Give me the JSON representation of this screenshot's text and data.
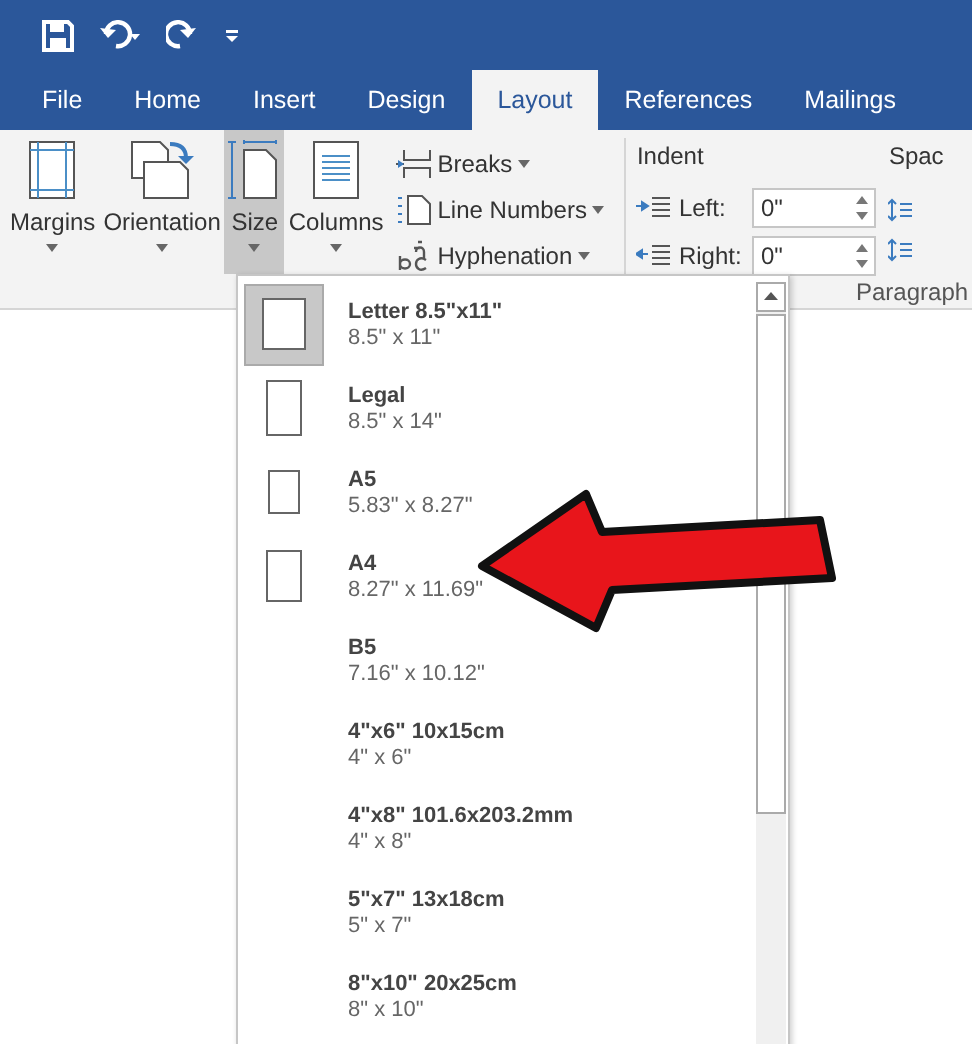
{
  "tabs": [
    {
      "label": "File",
      "selected": false
    },
    {
      "label": "Home",
      "selected": false
    },
    {
      "label": "Insert",
      "selected": false
    },
    {
      "label": "Design",
      "selected": false
    },
    {
      "label": "Layout",
      "selected": true
    },
    {
      "label": "References",
      "selected": false
    },
    {
      "label": "Mailings",
      "selected": false
    }
  ],
  "large_buttons": [
    {
      "kind": "margins",
      "label": "Margins",
      "selected": false
    },
    {
      "kind": "orientation",
      "label": "Orientation",
      "selected": false
    },
    {
      "kind": "size",
      "label": "Size",
      "selected": true
    },
    {
      "kind": "columns",
      "label": "Columns",
      "selected": false
    }
  ],
  "small_buttons": [
    {
      "kind": "breaks",
      "label": "Breaks"
    },
    {
      "kind": "line_numbers",
      "label": "Line Numbers"
    },
    {
      "kind": "hyphenation",
      "label": "Hyphenation"
    }
  ],
  "indent": {
    "title": "Indent",
    "fields": [
      {
        "kind": "left",
        "label": "Left:",
        "value": "0\""
      },
      {
        "kind": "right",
        "label": "Right:",
        "value": "0\""
      }
    ]
  },
  "spacing": {
    "title": "Spac"
  },
  "group_label": "Paragraph",
  "size_menu": [
    {
      "kind": "letter",
      "name": "Letter 8.5\"x11\"",
      "size": "8.5\" x 11\"",
      "selected": true
    },
    {
      "kind": "legal",
      "name": "Legal",
      "size": "8.5\" x 14\"",
      "selected": false
    },
    {
      "kind": "a5",
      "name": "A5",
      "size": "5.83\" x 8.27\"",
      "selected": false
    },
    {
      "kind": "a4",
      "name": "A4",
      "size": "8.27\" x 11.69\"",
      "selected": false
    },
    {
      "kind": "none",
      "name": "B5",
      "size": "7.16\" x 10.12\"",
      "selected": false
    },
    {
      "kind": "none",
      "name": "4\"x6\" 10x15cm",
      "size": "4\" x 6\"",
      "selected": false
    },
    {
      "kind": "none",
      "name": "4\"x8\" 101.6x203.2mm",
      "size": "4\" x 8\"",
      "selected": false
    },
    {
      "kind": "none",
      "name": "5\"x7\" 13x18cm",
      "size": "5\" x 7\"",
      "selected": false
    },
    {
      "kind": "none",
      "name": "8\"x10\" 20x25cm",
      "size": "8\" x 10\"",
      "selected": false
    }
  ]
}
